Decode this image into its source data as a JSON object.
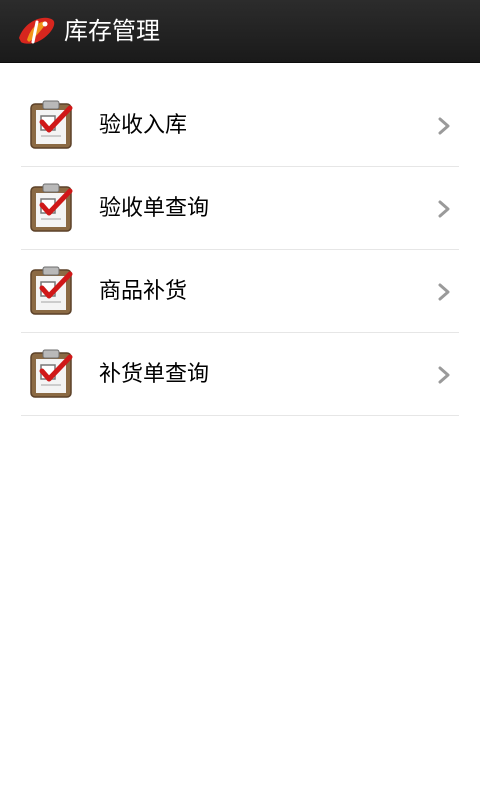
{
  "header": {
    "logo_icon": "app-logo-icon",
    "title": "库存管理",
    "background": "#222222"
  },
  "menu": {
    "items": [
      {
        "label": "验收入库",
        "icon": "clipboard-check-icon",
        "trailing_icon": "chevron-right-icon"
      },
      {
        "label": "验收单查询",
        "icon": "clipboard-check-icon",
        "trailing_icon": "chevron-right-icon"
      },
      {
        "label": "商品补货",
        "icon": "clipboard-check-icon",
        "trailing_icon": "chevron-right-icon"
      },
      {
        "label": "补货单查询",
        "icon": "clipboard-check-icon",
        "trailing_icon": "chevron-right-icon"
      }
    ]
  },
  "colors": {
    "accent_red": "#cc1a1a",
    "divider": "#e6e6e6",
    "chevron": "#9a9a9a"
  }
}
